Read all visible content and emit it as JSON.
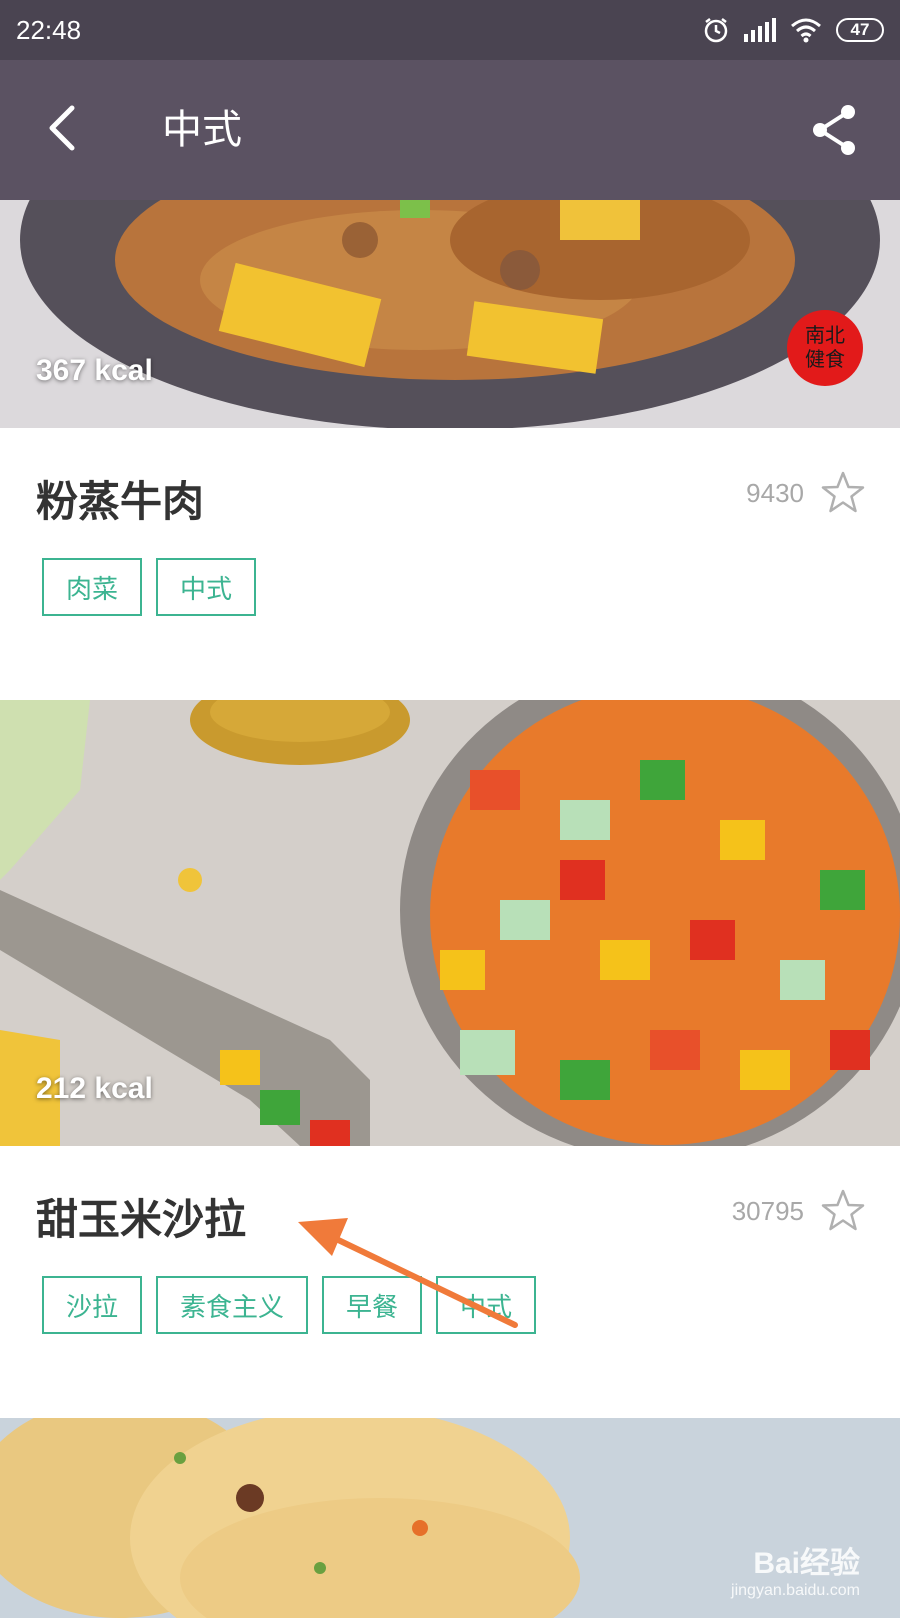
{
  "status_bar": {
    "time": "22:48",
    "battery": "47",
    "icons": [
      "alarm-icon",
      "signal-icon",
      "wifi-icon",
      "battery-icon"
    ]
  },
  "app_bar": {
    "title": "中式",
    "back_icon": "chevron-left-icon",
    "share_icon": "share-icon"
  },
  "recipes": [
    {
      "kcal": "367 kcal",
      "title": "粉蒸牛肉",
      "count": "9430",
      "tags": [
        "肉菜",
        "中式"
      ],
      "logo_text": "南北健食"
    },
    {
      "kcal": "212 kcal",
      "title": "甜玉米沙拉",
      "count": "30795",
      "tags": [
        "沙拉",
        "素食主义",
        "早餐",
        "中式"
      ]
    }
  ],
  "watermark": {
    "main": "Bai经验",
    "sub": "jingyan.baidu.com"
  },
  "colors": {
    "status_bar": "#4a4451",
    "app_bar": "#5b5262",
    "tag": "#3cb491",
    "arrow": "#f07a3a"
  }
}
